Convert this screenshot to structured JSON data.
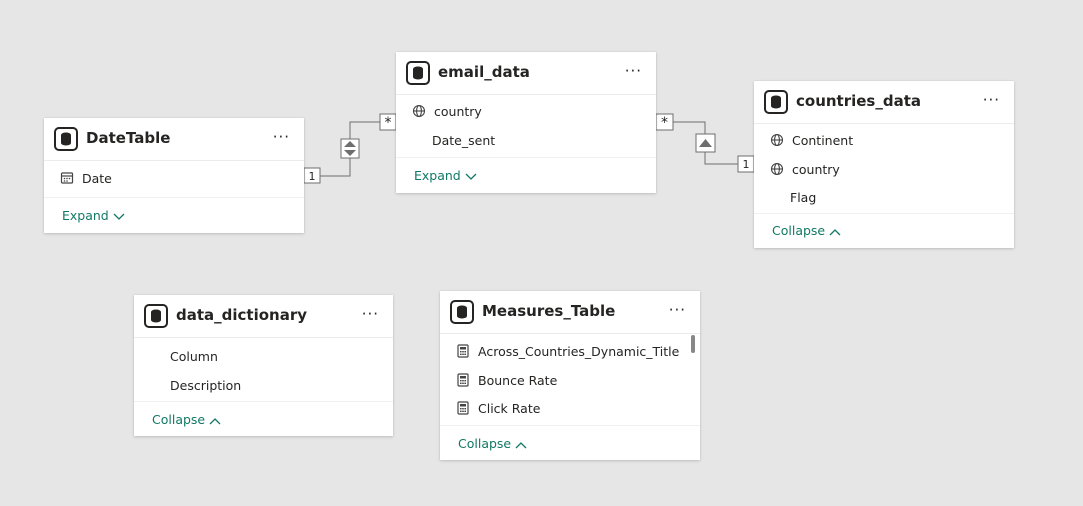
{
  "tables": {
    "datetable": {
      "title": "DateTable",
      "fields": [
        {
          "name": "Date",
          "icon": "calendar-icon"
        }
      ],
      "toggle": "Expand"
    },
    "email_data": {
      "title": "email_data",
      "fields": [
        {
          "name": "country",
          "icon": "globe-icon"
        },
        {
          "name": "Date_sent",
          "icon": ""
        }
      ],
      "toggle": "Expand"
    },
    "countries_data": {
      "title": "countries_data",
      "fields": [
        {
          "name": "Continent",
          "icon": "globe-icon"
        },
        {
          "name": "country",
          "icon": "globe-icon"
        },
        {
          "name": "Flag",
          "icon": ""
        }
      ],
      "toggle": "Collapse"
    },
    "data_dictionary": {
      "title": "data_dictionary",
      "fields": [
        {
          "name": "Column",
          "icon": ""
        },
        {
          "name": "Description",
          "icon": ""
        }
      ],
      "toggle": "Collapse"
    },
    "measures_table": {
      "title": "Measures_Table",
      "fields": [
        {
          "name": "Across_Countries_Dynamic_Title",
          "icon": "calculator-icon"
        },
        {
          "name": "Bounce Rate",
          "icon": "calculator-icon"
        },
        {
          "name": "Click Rate",
          "icon": "calculator-icon"
        }
      ],
      "toggle": "Collapse"
    }
  },
  "menu_glyph": "···",
  "relationships": {
    "date_email": {
      "from_cardinality": "1",
      "to_cardinality": "*",
      "filter_direction": "both"
    },
    "email_countries": {
      "from_cardinality": "*",
      "to_cardinality": "1",
      "filter_direction": "single"
    }
  },
  "colors": {
    "canvas": "#e6e6e6",
    "card": "#ffffff",
    "link_accent": "#117865",
    "line": "#6e6e6e"
  }
}
